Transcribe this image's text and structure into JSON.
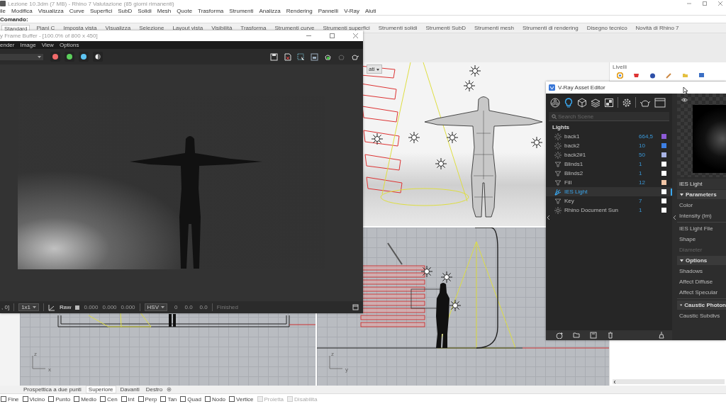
{
  "app_window": {
    "title": "Lezione 10.3dm (7 MB) - Rhino 7 Valutazione (85 giorni rimanenti)"
  },
  "menu_bar": [
    "ile",
    "Modifica",
    "Visualizza",
    "Curve",
    "Superfici",
    "SubD",
    "Solidi",
    "Mesh",
    "Quote",
    "Trasforma",
    "Strumenti",
    "Analizza",
    "Rendering",
    "Pannelli",
    "V-Ray",
    "Aiuti"
  ],
  "command_line": {
    "prompt": "Comando:"
  },
  "toolbar_tabs": [
    {
      "label": "Standard",
      "selected": true
    },
    {
      "label": "Piani C",
      "selected": false
    },
    {
      "label": "Imposta vista",
      "selected": false
    },
    {
      "label": "Visualizza",
      "selected": false
    },
    {
      "label": "Selezione",
      "selected": false
    },
    {
      "label": "Layout vista",
      "selected": false
    },
    {
      "label": "Visibilità",
      "selected": false
    },
    {
      "label": "Trasforma",
      "selected": false
    },
    {
      "label": "Strumenti curve",
      "selected": false
    },
    {
      "label": "Strumenti superfici",
      "selected": false
    },
    {
      "label": "Strumenti solidi",
      "selected": false
    },
    {
      "label": "Strumenti SubD",
      "selected": false
    },
    {
      "label": "Strumenti mesh",
      "selected": false
    },
    {
      "label": "Strumenti di rendering",
      "selected": false
    },
    {
      "label": "Disegno tecnico",
      "selected": false
    },
    {
      "label": "Novità di Rhino 7",
      "selected": false
    }
  ],
  "viewports": [
    {
      "kind": "perspective",
      "title": "ati"
    },
    {
      "kind": "top",
      "axes": [
        "z",
        "x"
      ]
    },
    {
      "kind": "side",
      "axes": [
        "z",
        "y"
      ]
    }
  ],
  "layers_panel": {
    "title": "Livelli"
  },
  "viewport_tabs": [
    {
      "label": "Prospettica a due punti",
      "selected": false
    },
    {
      "label": "Superiore",
      "selected": true
    },
    {
      "label": "Davanti",
      "selected": false
    },
    {
      "label": "Destro",
      "selected": false
    }
  ],
  "osnaps": [
    {
      "label": "Fine",
      "checked": false,
      "disabled": false
    },
    {
      "label": "Vicino",
      "checked": false,
      "disabled": false
    },
    {
      "label": "Punto",
      "checked": false,
      "disabled": false
    },
    {
      "label": "Medio",
      "checked": false,
      "disabled": false
    },
    {
      "label": "Cen",
      "checked": false,
      "disabled": false
    },
    {
      "label": "Int",
      "checked": false,
      "disabled": false
    },
    {
      "label": "Perp",
      "checked": false,
      "disabled": false
    },
    {
      "label": "Tan",
      "checked": false,
      "disabled": false
    },
    {
      "label": "Quad",
      "checked": false,
      "disabled": false
    },
    {
      "label": "Nodo",
      "checked": false,
      "disabled": false
    },
    {
      "label": "Vertice",
      "checked": false,
      "disabled": false
    },
    {
      "label": "Proietta",
      "checked": false,
      "disabled": true
    },
    {
      "label": "Disabilita",
      "checked": false,
      "disabled": true
    }
  ],
  "frame_buffer": {
    "title": "y Frame Buffer - [100.0% of 800 x 450]",
    "menu": [
      "ender",
      "Image",
      "View",
      "Options"
    ],
    "channel_buttons": [
      {
        "kind": "dot",
        "color": "#f06a6a"
      },
      {
        "kind": "dot",
        "color": "#5ccf5c"
      },
      {
        "kind": "dot",
        "color": "#5ec4f2"
      },
      {
        "kind": "mono"
      }
    ],
    "status": {
      "coords": ", 0]",
      "zoom": "1x1",
      "raw_label": "Raw",
      "raw_checked": false,
      "values": [
        "0.000",
        "0.000",
        "0.000"
      ],
      "color_mode": "HSV",
      "hsv": [
        "0",
        "0.0",
        "0.0"
      ],
      "state": "Finished"
    }
  },
  "asset_editor": {
    "title": "V-Ray Asset Editor",
    "categories": [
      {
        "kind": "materials",
        "selected": false
      },
      {
        "kind": "lights",
        "selected": true
      },
      {
        "kind": "geometry",
        "selected": false
      },
      {
        "kind": "textures",
        "selected": false
      },
      {
        "kind": "render_elements",
        "selected": false
      }
    ],
    "search": {
      "placeholder": "Search Scene"
    },
    "section": "Lights",
    "lights": [
      {
        "kind": "rect",
        "name": "back1",
        "value": "664,5",
        "color": "#8d5ad6",
        "selected": false
      },
      {
        "kind": "rect",
        "name": "back2",
        "value": "10",
        "color": "#3d7fe4",
        "selected": false
      },
      {
        "kind": "rect",
        "name": "back2#1",
        "value": "50",
        "color": "#a9b4e6",
        "selected": false
      },
      {
        "kind": "spot",
        "name": "Blinds1",
        "value": "1",
        "color": "#ffffff",
        "selected": false
      },
      {
        "kind": "spot",
        "name": "Blinds2",
        "value": "1",
        "color": "#ffffff",
        "selected": false
      },
      {
        "kind": "spot",
        "name": "Fill",
        "value": "12",
        "color": "#f3c6a6",
        "selected": false
      },
      {
        "kind": "ies",
        "name": "IES Light",
        "color": "#ffffff",
        "selected": true
      },
      {
        "kind": "spot",
        "name": "Key",
        "value": "7",
        "color": "#ffffff",
        "selected": false
      },
      {
        "kind": "sun",
        "name": "Rhino Document Sun",
        "value": "1",
        "color": "#ffffff",
        "selected": false
      }
    ],
    "panel_title": "IES Light",
    "params": [
      {
        "kind": "section",
        "label": "Parameters"
      },
      {
        "kind": "param",
        "label": "Color",
        "disabled": false
      },
      {
        "kind": "param",
        "label": "Intensity (lm)",
        "disabled": false
      },
      {
        "kind": "divider"
      },
      {
        "kind": "param",
        "label": "IES Light File",
        "disabled": false
      },
      {
        "kind": "param",
        "label": "Shape",
        "disabled": false
      },
      {
        "kind": "param",
        "label": "Diameter",
        "disabled": true
      },
      {
        "kind": "section",
        "label": "Options"
      },
      {
        "kind": "param",
        "label": "Shadows",
        "disabled": false
      },
      {
        "kind": "param",
        "label": "Affect Diffuse",
        "disabled": false
      },
      {
        "kind": "param",
        "label": "Affect Specular",
        "disabled": false
      },
      {
        "kind": "divider"
      },
      {
        "kind": "section",
        "label": "Caustic Photon"
      },
      {
        "kind": "param",
        "label": "Caustic Subdivs",
        "disabled": false
      }
    ]
  }
}
